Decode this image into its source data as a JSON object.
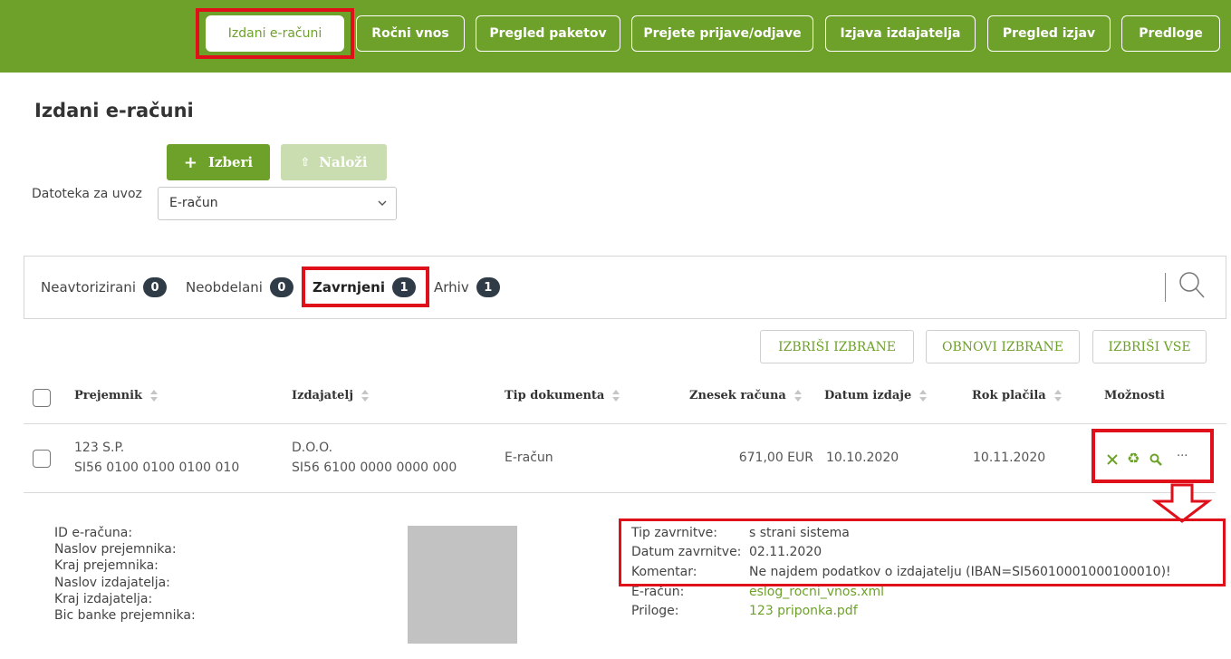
{
  "nav": {
    "items": [
      {
        "label": "Izdani e-računi",
        "active": true
      },
      {
        "label": "Ročni vnos"
      },
      {
        "label": "Pregled paketov"
      },
      {
        "label": "Prejete prijave/odjave"
      },
      {
        "label": "Izjava izdajatelja"
      },
      {
        "label": "Pregled izjav"
      },
      {
        "label": "Predloge"
      }
    ]
  },
  "page": {
    "title": "Izdani e-računi",
    "choose_label": "Izberi",
    "upload_label": "Naloži",
    "import_label": "Datoteka za uvoz",
    "import_value": "E-račun"
  },
  "tabs": [
    {
      "label": "Neavtorizirani",
      "count": "0"
    },
    {
      "label": "Neobdelani",
      "count": "0"
    },
    {
      "label": "Zavrnjeni",
      "count": "1",
      "active": true
    },
    {
      "label": "Arhiv",
      "count": "1"
    }
  ],
  "actions": {
    "delete_selected": "IZBRIŠI IZBRANE",
    "restore_selected": "OBNOVI IZBRANE",
    "delete_all": "IZBRIŠI VSE"
  },
  "table": {
    "headers": {
      "recipient": "Prejemnik",
      "issuer": "Izdajatelj",
      "doc_type": "Tip dokumenta",
      "amount": "Znesek računa",
      "issue_date": "Datum izdaje",
      "due_date": "Rok plačila",
      "options": "Možnosti"
    },
    "row": {
      "recipient_name": "123 S.P.",
      "recipient_iban": "SI56 0100 0100 0100 010",
      "issuer_name": "D.O.O.",
      "issuer_iban": "SI56 6100 0000 0000 000",
      "doc_type": "E-račun",
      "amount": "671,00 EUR",
      "issue_date": "10.10.2020",
      "due_date": "10.11.2020",
      "more": "···"
    }
  },
  "details": {
    "labels": {
      "id": "ID e-računa:",
      "recipient_address": "Naslov prejemnika:",
      "recipient_city": "Kraj prejemnika:",
      "issuer_address": "Naslov izdajatelja:",
      "issuer_city": "Kraj izdajatelja:",
      "bic": "Bic banke prejemnika:"
    },
    "rejection": {
      "type_label": "Tip zavrnitve:",
      "type_value": "s strani sistema",
      "date_label": "Datum zavrnitve:",
      "date_value": "02.11.2020",
      "comment_label": "Komentar:",
      "comment_value": "Ne najdem podatkov o izdajatelju (IBAN=SI56010001000100010)!",
      "einvoice_label": "E-račun:",
      "einvoice_file": "eslog_rocni_vnos.xml",
      "attachments_label": "Priloge:",
      "attachment_file": "123 priponka.pdf"
    }
  },
  "colors": {
    "brand_green": "#6ea12a",
    "highlight_red": "#e0101b",
    "badge_dark": "#2f3c47"
  }
}
